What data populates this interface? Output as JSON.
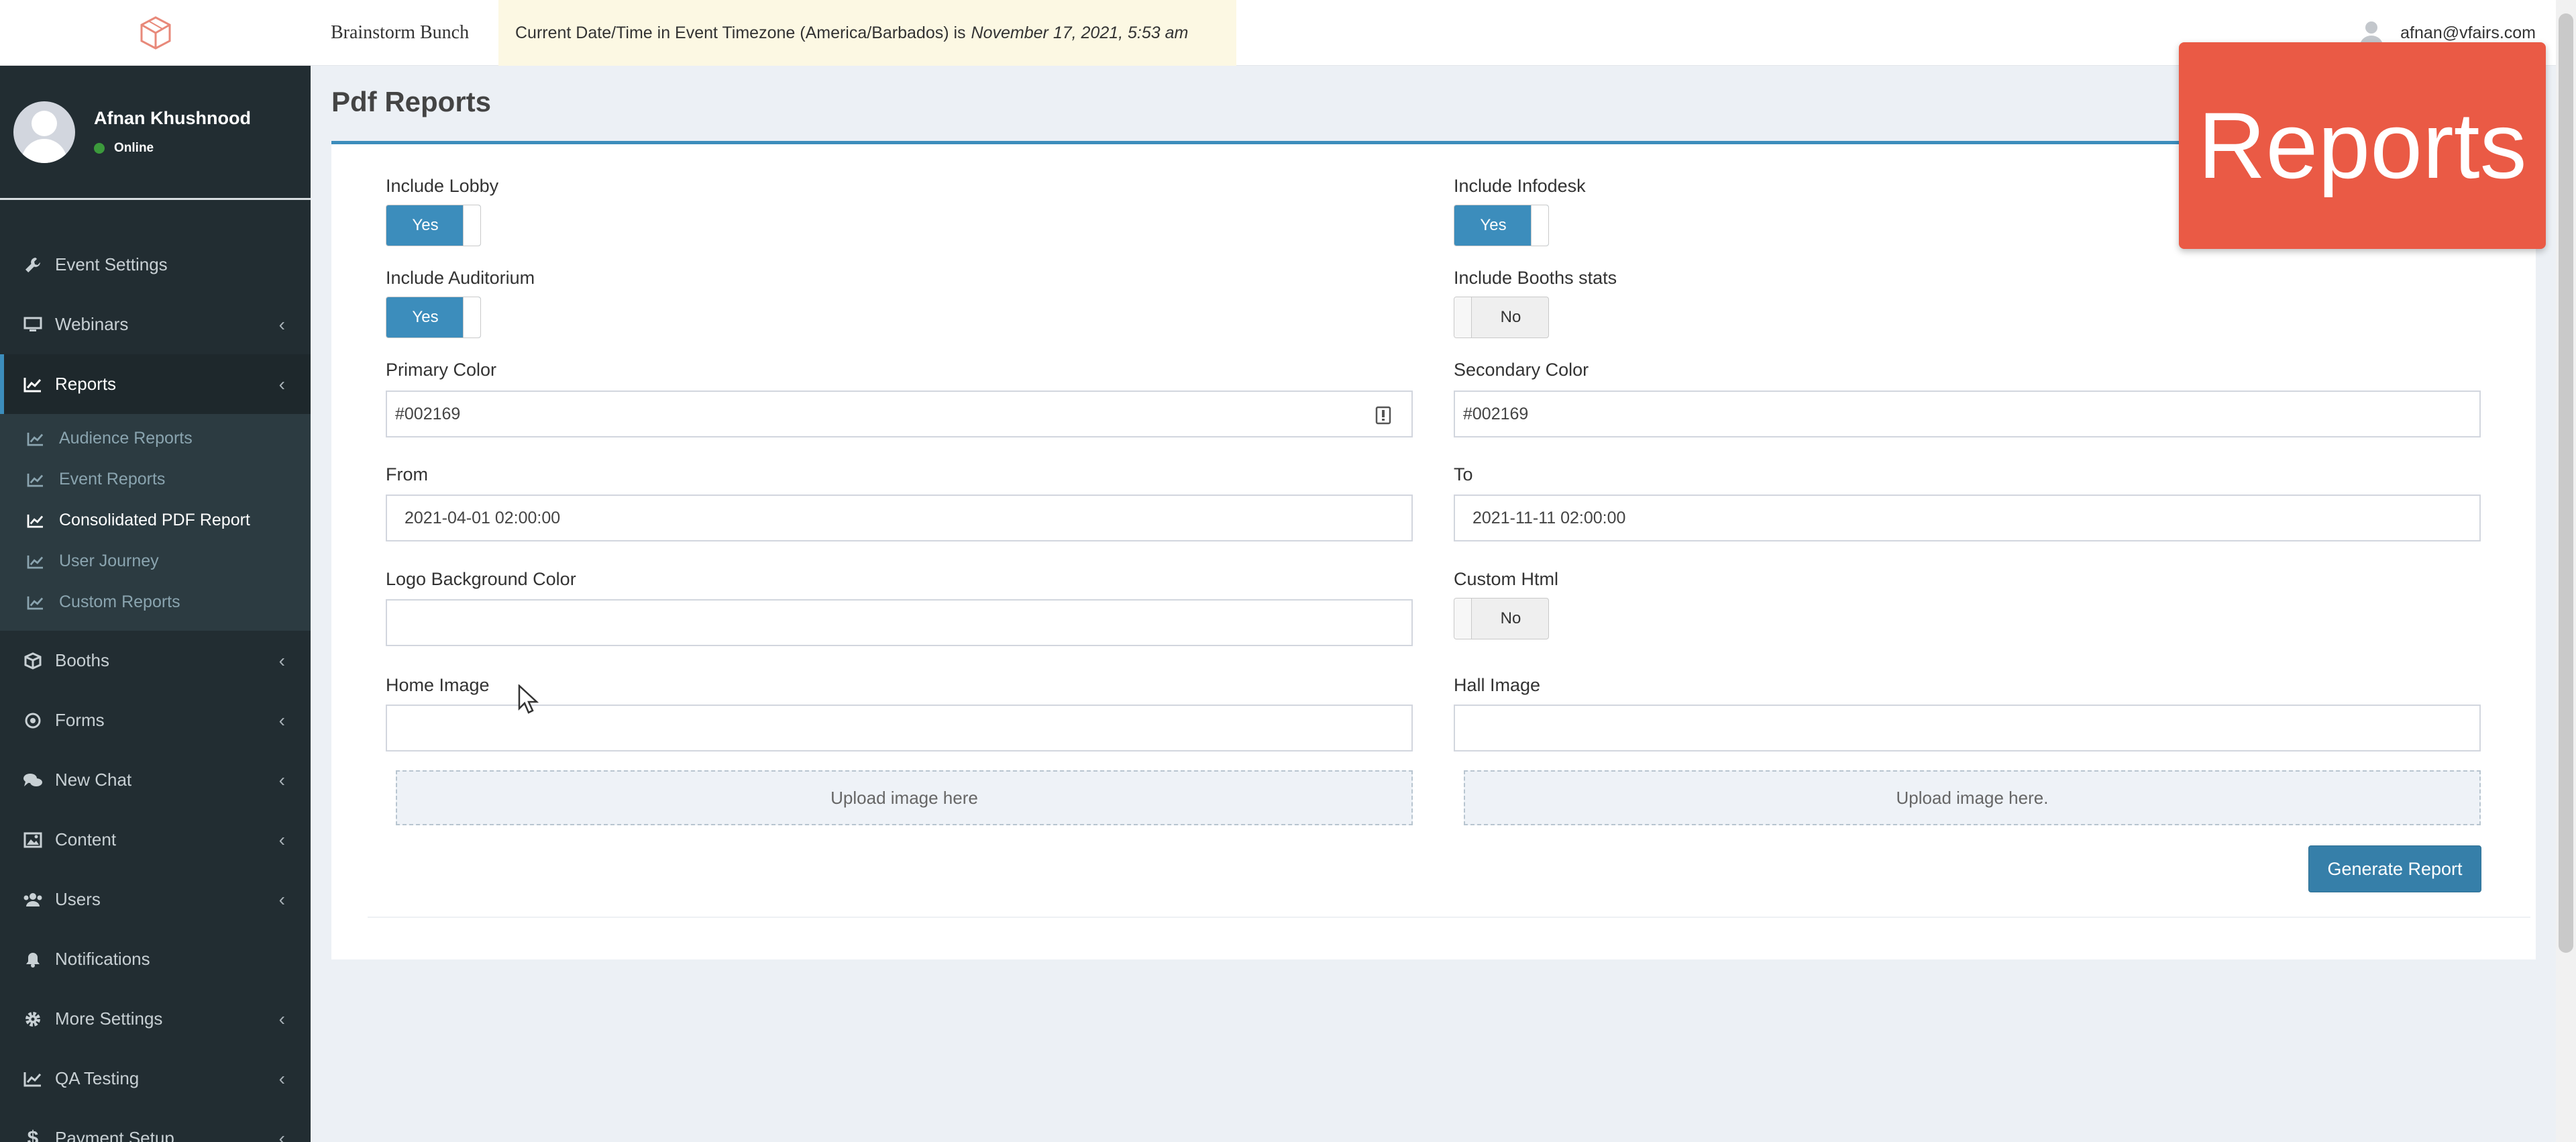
{
  "sidebar": {
    "user": {
      "name": "Afnan Khushnood",
      "status": "Online"
    },
    "items": [
      {
        "label": "Event Settings",
        "icon": "wrench-icon",
        "chevron": false
      },
      {
        "label": "Webinars",
        "icon": "monitor-icon",
        "chevron": true
      },
      {
        "label": "Reports",
        "icon": "chart-line-icon",
        "chevron": true,
        "active": true
      },
      {
        "label": "Booths",
        "icon": "cube-icon",
        "chevron": true
      },
      {
        "label": "Forms",
        "icon": "dot-circle-icon",
        "chevron": true
      },
      {
        "label": "New Chat",
        "icon": "comments-icon",
        "chevron": true
      },
      {
        "label": "Content",
        "icon": "image-icon",
        "chevron": true
      },
      {
        "label": "Users",
        "icon": "users-icon",
        "chevron": true
      },
      {
        "label": "Notifications",
        "icon": "bell-icon",
        "chevron": false
      },
      {
        "label": "More Settings",
        "icon": "cog-icon",
        "chevron": true
      },
      {
        "label": "QA Testing",
        "icon": "chart-line-icon",
        "chevron": true
      },
      {
        "label": "Payment Setup",
        "icon": "dollar-icon",
        "chevron": true
      }
    ],
    "reports_submenu": [
      {
        "label": "Audience Reports"
      },
      {
        "label": "Event Reports"
      },
      {
        "label": "Consolidated PDF Report",
        "current": true
      },
      {
        "label": "User Journey"
      },
      {
        "label": "Custom Reports"
      }
    ]
  },
  "topbar": {
    "brand": "Brainstorm Bunch",
    "timezone_text": "Current Date/Time in Event Timezone (America/Barbados) is",
    "timezone_value": "November 17, 2021, 5:53 am",
    "account_email": "afnan@vfairs.com"
  },
  "page": {
    "title": "Pdf Reports"
  },
  "form": {
    "include_lobby": {
      "label": "Include Lobby",
      "value": "Yes"
    },
    "include_infodesk": {
      "label": "Include Infodesk",
      "value": "Yes"
    },
    "include_auditorium": {
      "label": "Include Auditorium",
      "value": "Yes"
    },
    "include_booths_stats": {
      "label": "Include Booths stats",
      "value": "No"
    },
    "primary_color": {
      "label": "Primary Color",
      "value": "#002169"
    },
    "secondary_color": {
      "label": "Secondary Color",
      "value": "#002169"
    },
    "from": {
      "label": "From",
      "value": "2021-04-01 02:00:00"
    },
    "to": {
      "label": "To",
      "value": "2021-11-11 02:00:00"
    },
    "logo_bg_color": {
      "label": "Logo Background Color",
      "value": ""
    },
    "custom_html": {
      "label": "Custom Html",
      "value": "No"
    },
    "home_image": {
      "label": "Home Image",
      "value": "",
      "upload_text": "Upload image here"
    },
    "hall_image": {
      "label": "Hall Image",
      "value": "",
      "upload_text": "Upload image here."
    },
    "generate_label": "Generate Report"
  },
  "overlay": {
    "text": "Reports"
  },
  "colors": {
    "sidebar_bg": "#222d32",
    "accent": "#3c8dbc",
    "banner": "#fcf8e3",
    "overlay": "#ea5a45"
  }
}
